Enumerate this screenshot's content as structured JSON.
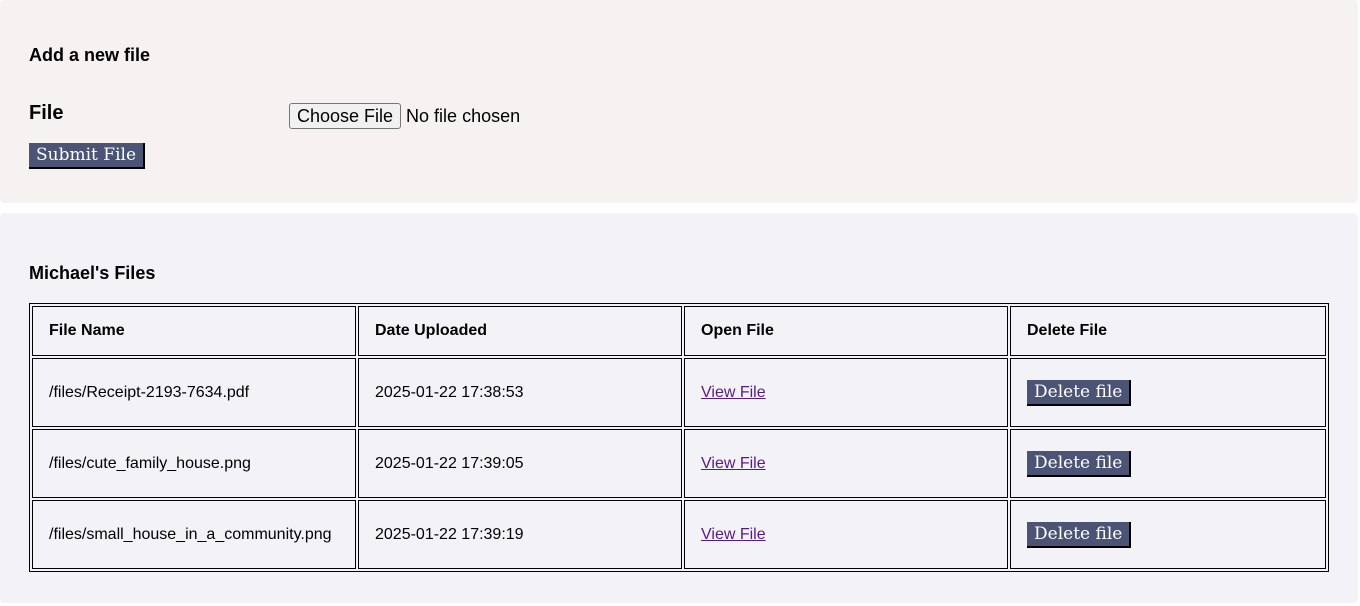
{
  "upload": {
    "heading": "Add a new file",
    "file_label": "File",
    "choose_label": "Choose File",
    "no_file_text": "No file chosen",
    "submit_label": "Submit File"
  },
  "files": {
    "heading": "Michael's Files",
    "columns": [
      "File Name",
      "Date Uploaded",
      "Open File",
      "Delete File"
    ],
    "rows": [
      {
        "name": "/files/Receipt-2193-7634.pdf",
        "date": "2025-01-22 17:38:53",
        "open_label": "View File",
        "delete_label": "Delete file"
      },
      {
        "name": "/files/cute_family_house.png",
        "date": "2025-01-22 17:39:05",
        "open_label": "View File",
        "delete_label": "Delete file"
      },
      {
        "name": "/files/small_house_in_a_community.png",
        "date": "2025-01-22 17:39:19",
        "open_label": "View File",
        "delete_label": "Delete file"
      }
    ]
  },
  "colors": {
    "upload_panel_bg": "#f5f2f1",
    "files_panel_bg": "#f3f2f6",
    "button_bg": "#4b5474",
    "visited_link": "#551a8b"
  }
}
